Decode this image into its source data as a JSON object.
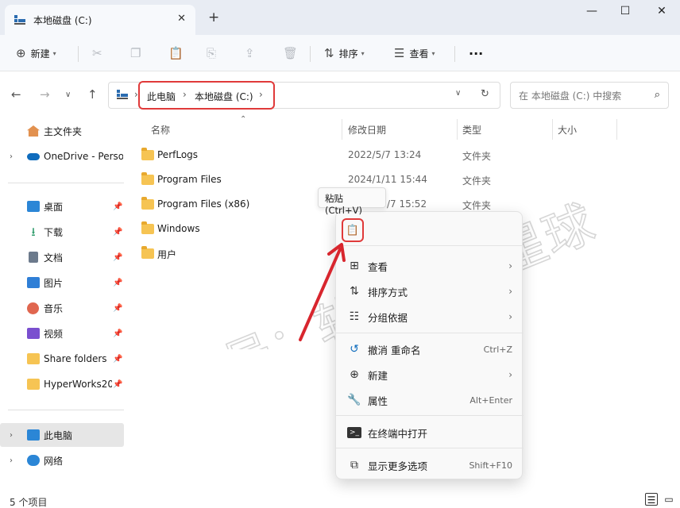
{
  "window": {
    "tab_title": "本地磁盘 (C:)",
    "tab_close": "✕",
    "new_tab": "+",
    "minimize": "—",
    "maximize": "☐",
    "close": "✕"
  },
  "toolbar": {
    "new_label": "新建",
    "sort_label": "排序",
    "view_label": "查看",
    "more": "···"
  },
  "address": {
    "crumbs": [
      "此电脑",
      "本地磁盘 (C:)"
    ],
    "search_placeholder": "在 本地磁盘 (C:) 中搜索"
  },
  "sidebar": {
    "items": [
      {
        "label": "主文件夹",
        "icon": "home-icon",
        "color": "#e2914f"
      },
      {
        "label": "OneDrive - Perso",
        "icon": "cloud-icon",
        "color": "#0f6cbd"
      },
      {
        "label": "桌面",
        "icon": "desktop-icon",
        "color": "#2b86d6"
      },
      {
        "label": "下载",
        "icon": "download-icon",
        "color": "#2c9a6a"
      },
      {
        "label": "文档",
        "icon": "document-icon",
        "color": "#6c7a8c"
      },
      {
        "label": "图片",
        "icon": "pictures-icon",
        "color": "#2f7fd6"
      },
      {
        "label": "音乐",
        "icon": "music-icon",
        "color": "#e0664f"
      },
      {
        "label": "视频",
        "icon": "video-icon",
        "color": "#7a4fcf"
      },
      {
        "label": "Share folders",
        "icon": "folder-icon",
        "color": "#f6c453"
      },
      {
        "label": "HyperWorks20",
        "icon": "folder-icon",
        "color": "#f6c453"
      },
      {
        "label": "此电脑",
        "icon": "computer-icon",
        "color": "#2b86d6"
      },
      {
        "label": "网络",
        "icon": "network-icon",
        "color": "#2b86d6"
      }
    ]
  },
  "columns": {
    "name": "名称",
    "modified": "修改日期",
    "type": "类型",
    "size": "大小"
  },
  "files": [
    {
      "name": "PerfLogs",
      "date": "2022/5/7 13:24",
      "type": "文件夹"
    },
    {
      "name": "Program Files",
      "date": "2024/1/11 15:44",
      "type": "文件夹"
    },
    {
      "name": "Program Files (x86)",
      "date": "/7 15:52",
      "type": "文件夹"
    },
    {
      "name": "Windows",
      "date": "",
      "type": ""
    },
    {
      "name": "用户",
      "date": "",
      "type": ""
    }
  ],
  "tooltip": "粘贴 (Ctrl+V)",
  "context_menu": {
    "view": "查看",
    "sort": "排序方式",
    "group": "分组依据",
    "undo": "撤消 重命名",
    "undo_key": "Ctrl+Z",
    "new": "新建",
    "properties": "属性",
    "properties_key": "Alt+Enter",
    "terminal": "在终端中打开",
    "more": "显示更多选项",
    "more_key": "Shift+F10"
  },
  "status": {
    "count": "5 个项目"
  },
  "watermark": "公众号：软件技术星球",
  "colors": {
    "accent": "#0f6cbd",
    "highlight": "#e03a3a"
  }
}
